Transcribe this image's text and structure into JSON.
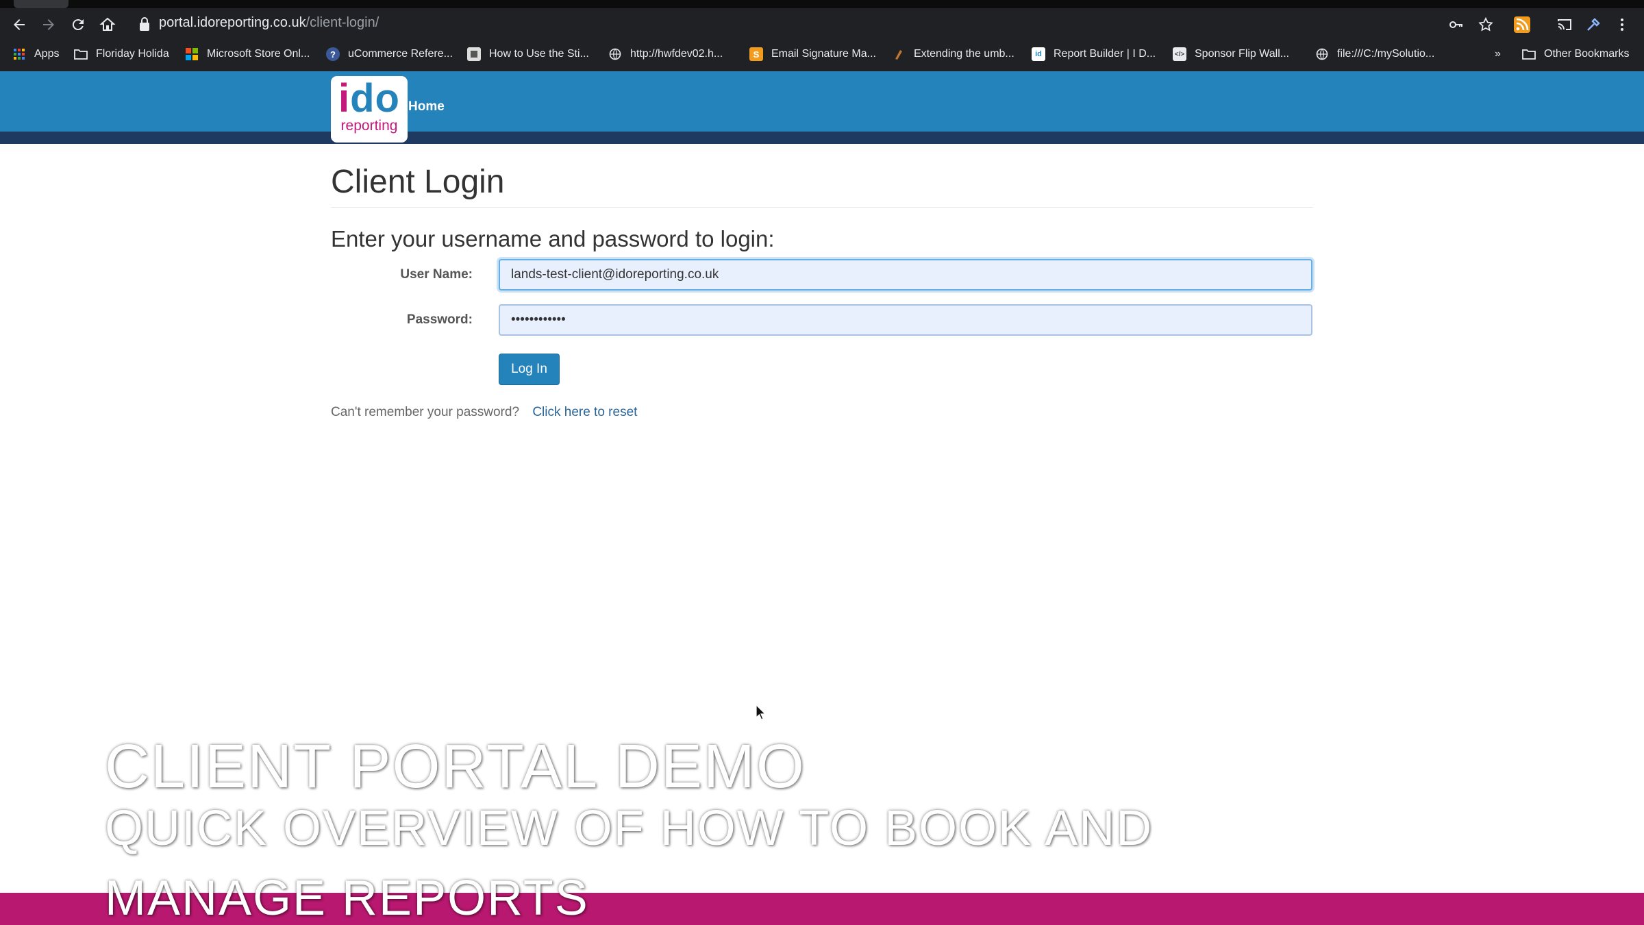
{
  "browser": {
    "url_host": "portal.idoreporting.co.uk",
    "url_path": "/client-login/",
    "bookmarks": [
      {
        "label": "Apps",
        "icon": "apps-grid-icon"
      },
      {
        "label": "Floriday Holida",
        "icon": "folder-icon"
      },
      {
        "label": "Microsoft Store Onl...",
        "icon": "microsoft-icon"
      },
      {
        "label": "uCommerce Refere...",
        "icon": "ucommerce-icon"
      },
      {
        "label": "How to Use the Sti...",
        "icon": "page-icon"
      },
      {
        "label": "http://hwfdev02.h...",
        "icon": "globe-icon"
      },
      {
        "label": "Email Signature Ma...",
        "icon": "s-icon"
      },
      {
        "label": "Extending the umb...",
        "icon": "umbraco-icon"
      },
      {
        "label": "Report Builder | I D...",
        "icon": "ido-icon"
      },
      {
        "label": "Sponsor Flip Wall...",
        "icon": "code-icon"
      },
      {
        "label": "file:///C:/mySolutio...",
        "icon": "globe-icon"
      }
    ],
    "more_label": "»",
    "other_bookmarks": "Other Bookmarks"
  },
  "site": {
    "logo_i": "i",
    "logo_do": "do",
    "logo_sub": "reporting",
    "nav_home": "Home"
  },
  "login": {
    "title": "Client Login",
    "subheading": "Enter your username and password to login:",
    "username_label": "User Name:",
    "username_value": "lands-test-client@idoreporting.co.uk",
    "password_label": "Password:",
    "password_value": "••••••••••••",
    "button_label": "Log In",
    "reset_prompt": "Can't remember your password?",
    "reset_link": "Click here to reset"
  },
  "overlay": {
    "title": "CLIENT PORTAL DEMO",
    "subtitle": "QUICK OVERVIEW OF HOW TO BOOK AND MANAGE REPORTS"
  },
  "colors": {
    "brand_blue": "#2583bb",
    "brand_dark": "#1f3a60",
    "brand_magenta": "#c2197a",
    "overlay_bar": "#b8186f"
  }
}
